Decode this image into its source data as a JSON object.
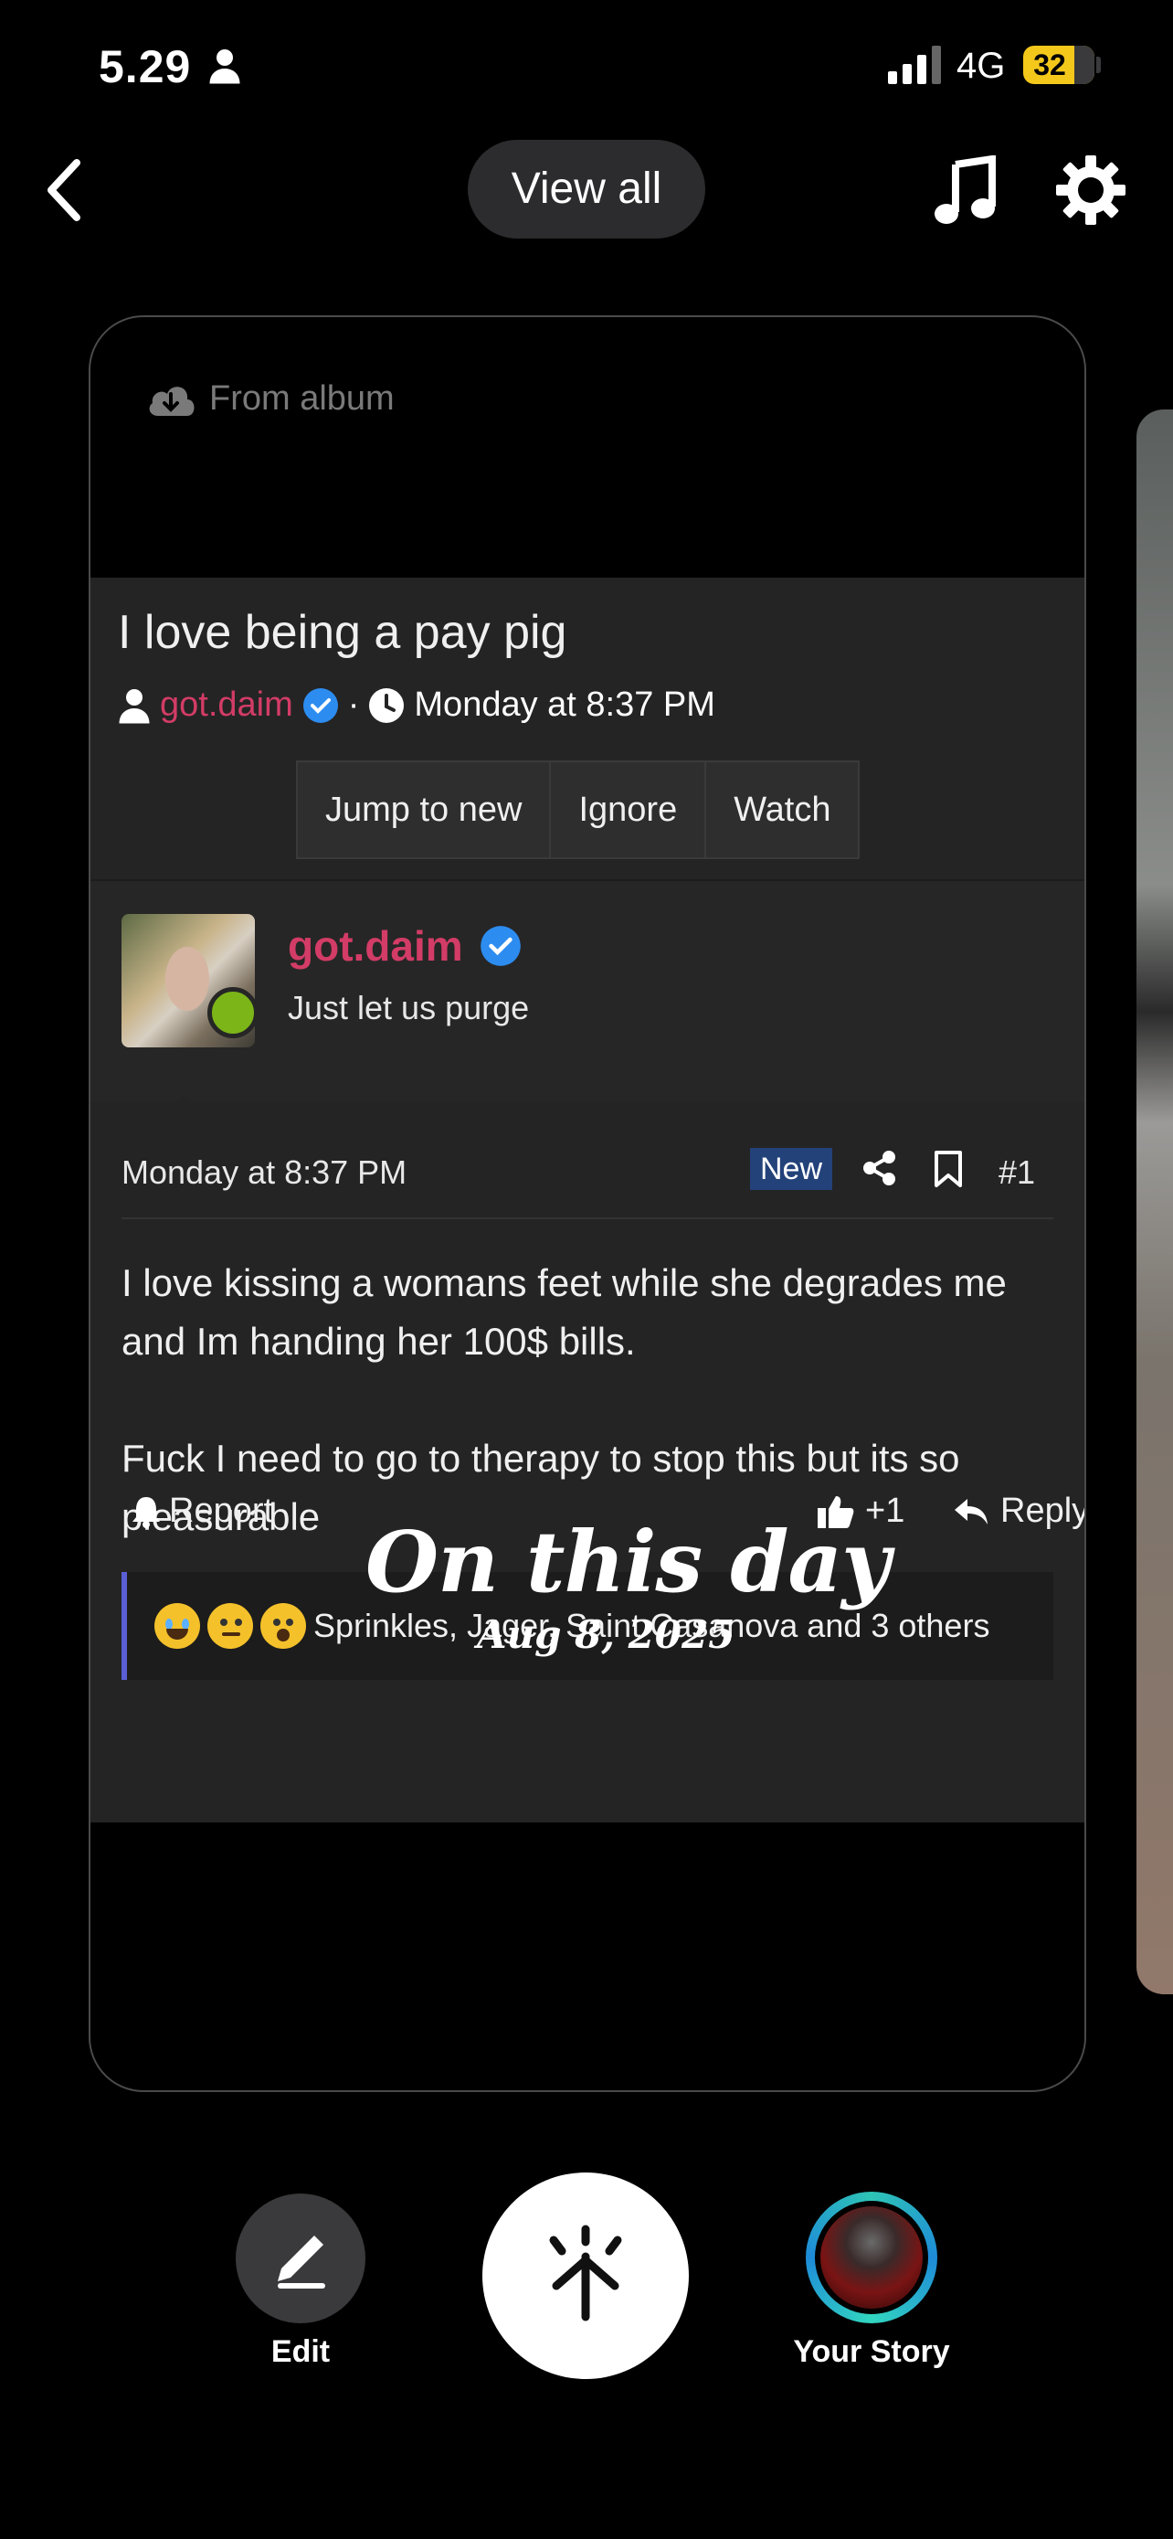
{
  "status_bar": {
    "time": "5.29",
    "network": "4G",
    "battery": "32"
  },
  "header": {
    "view_all_label": "View all"
  },
  "memory": {
    "source_label": "From album",
    "sticker_title": "On this day",
    "sticker_date": "Aug 8, 2025"
  },
  "thread": {
    "title": "I love being a pay pig",
    "author": "got.daim",
    "separator": "·",
    "timestamp": "Monday at 8:37 PM",
    "actions": [
      "Jump to new",
      "Ignore",
      "Watch"
    ]
  },
  "post": {
    "author": "got.daim",
    "tagline": "Just let us purge",
    "date": "Monday at 8:37 PM",
    "badge": "New",
    "number": "#1",
    "body": [
      "I love kissing a womans feet while she degrades me and Im handing her 100$ bills.",
      "Fuck I need to go to therapy to stop this but its so pleasurable"
    ],
    "report_label": "Report",
    "like_count": "+1",
    "reply_label": "Reply",
    "reactions_text": "Sprinkles, Jager, Saint Casanova and 3 others"
  },
  "bottom_bar": {
    "edit_label": "Edit",
    "story_label": "Your Story"
  },
  "colors": {
    "username": "#d23c66",
    "badge_bg": "#23427a",
    "verified": "#2d8cf0",
    "online": "#7cb518",
    "battery": "#f4c81b"
  },
  "icons": [
    "person-icon",
    "signal-icon",
    "back-chevron-icon",
    "music-note-icon",
    "gear-icon",
    "cloud-download-icon",
    "verified-icon",
    "clock-icon",
    "share-icon",
    "bookmark-icon",
    "bell-icon",
    "thumbs-up-icon",
    "reply-arrow-icon",
    "pencil-icon",
    "capture-icon"
  ]
}
